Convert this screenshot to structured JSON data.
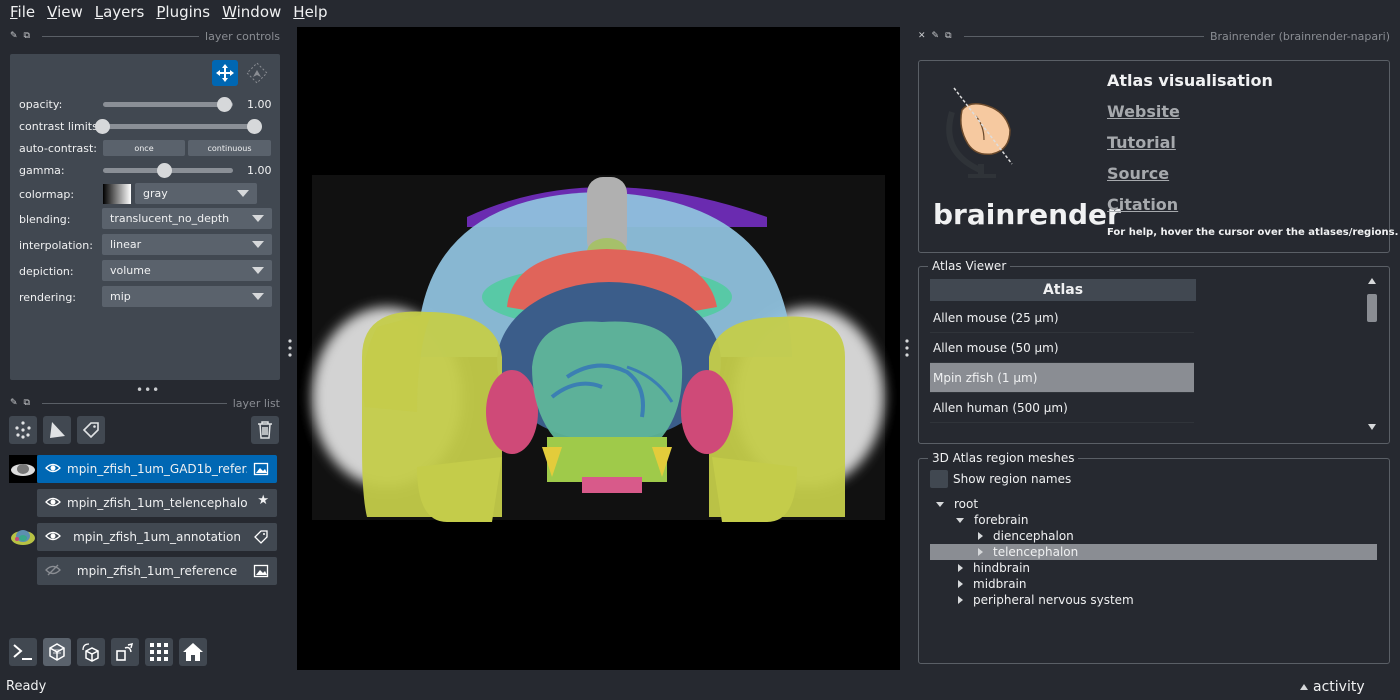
{
  "menu": [
    {
      "underline": "F",
      "rest": "ile"
    },
    {
      "underline": "V",
      "rest": "iew"
    },
    {
      "underline": "L",
      "rest": "ayers"
    },
    {
      "underline": "P",
      "rest": "lugins"
    },
    {
      "underline": "W",
      "rest": "indow"
    },
    {
      "underline": "H",
      "rest": "elp"
    }
  ],
  "layer_controls": {
    "title": "layer controls",
    "opacity_label": "opacity:",
    "opacity_value": "1.00",
    "opacity": 1.0,
    "contrast_label": "contrast limits:",
    "contrast_range": [
      0.0,
      1.0
    ],
    "auto_contrast_label": "auto-contrast:",
    "once_label": "once",
    "continuous_label": "continuous",
    "gamma_label": "gamma:",
    "gamma_value": "1.00",
    "gamma": 0.5,
    "colormap_label": "colormap:",
    "colormap_value": "gray",
    "blending_label": "blending:",
    "blending_value": "translucent_no_depth",
    "interpolation_label": "interpolation:",
    "interpolation_value": "linear",
    "depiction_label": "depiction:",
    "depiction_value": "volume",
    "rendering_label": "rendering:",
    "rendering_value": "mip"
  },
  "layer_list": {
    "title": "layer list",
    "layers": [
      {
        "name": "mpin_zfish_1um_GAD1b_refer...",
        "visible": true,
        "selected": true,
        "type": "image-icon"
      },
      {
        "name": "mpin_zfish_1um_telencephalo...",
        "visible": true,
        "selected": false,
        "type": "star-icon"
      },
      {
        "name": "mpin_zfish_1um_annotation",
        "visible": true,
        "selected": false,
        "type": "label-icon"
      },
      {
        "name": "mpin_zfish_1um_reference",
        "visible": false,
        "selected": false,
        "type": "image-icon"
      }
    ]
  },
  "plugin": {
    "dock_title": "Brainrender (brainrender-napari)",
    "heading": "Atlas visualisation",
    "logo_text": "brainrender",
    "links": [
      "Website",
      "Tutorial",
      "Source",
      "Citation"
    ],
    "help_text": "For help, hover the cursor over the atlases/regions.",
    "atlas_viewer_title": "Atlas Viewer",
    "atlas_column_header": "Atlas",
    "atlases": [
      "Allen mouse (25 μm)",
      "Allen mouse (50 μm)",
      "Mpin zfish (1 μm)",
      "Allen human (500 μm)"
    ],
    "selected_atlas": "Mpin zfish (1 μm)",
    "meshes_title": "3D Atlas region meshes",
    "show_region_names_label": "Show region names",
    "show_region_names": false,
    "tree": {
      "root": "root",
      "forebrain": "forebrain",
      "diencephalon": "diencephalon",
      "telencephalon": "telencephalon",
      "hindbrain": "hindbrain",
      "midbrain": "midbrain",
      "pns": "peripheral nervous system"
    },
    "selected_region": "telencephalon"
  },
  "status": {
    "text": "Ready",
    "activity_label": "activity"
  },
  "colors": {
    "background": "#262930",
    "panel": "#414851",
    "highlight": "#0067b3",
    "selection_gray": "#8a8d93"
  }
}
